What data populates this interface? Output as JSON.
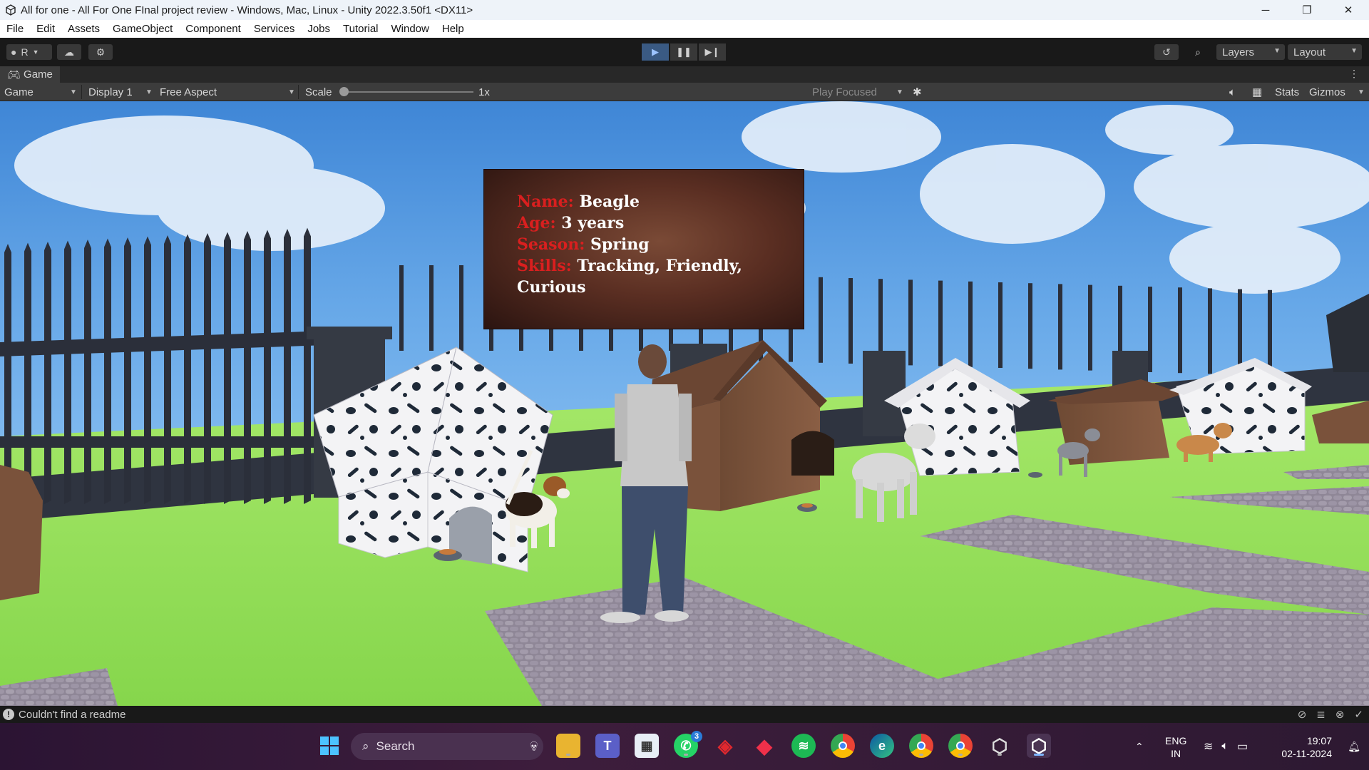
{
  "window": {
    "title": "All for one - All For One FInal project review - Windows, Mac, Linux - Unity 2022.3.50f1 <DX11>",
    "minimize": "─",
    "maximize": "❐",
    "close": "✕"
  },
  "menu": [
    "File",
    "Edit",
    "Assets",
    "GameObject",
    "Component",
    "Services",
    "Jobs",
    "Tutorial",
    "Window",
    "Help"
  ],
  "toolbar": {
    "account_label": "R",
    "layers_label": "Layers",
    "layout_label": "Layout"
  },
  "tab": {
    "label": "Game",
    "menu": "⋮"
  },
  "gamebar": {
    "view_mode": "Game",
    "display": "Display 1",
    "aspect": "Free Aspect",
    "scale_label": "Scale",
    "scale_value": "1x",
    "play_mode": "Play Focused",
    "stats_label": "Stats",
    "gizmos_label": "Gizmos"
  },
  "info_panel": {
    "name_label": "Name:",
    "name_value": "Beagle",
    "age_label": "Age:",
    "age_value": "3 years",
    "season_label": "Season:",
    "season_value": "Spring",
    "skills_label": "Skills:",
    "skills_value": "Tracking, Friendly,",
    "skills_value_cont": "Curious"
  },
  "status": {
    "message": "Couldn't find a readme",
    "icon": "!"
  },
  "taskbar": {
    "search_placeholder": "Search",
    "whatsapp_badge": "3",
    "lang_top": "ENG",
    "lang_bottom": "IN",
    "time": "19:07",
    "date": "02-11-2024"
  },
  "colors": {
    "label_red": "#d91f1f",
    "unity_dark": "#191919",
    "play_active": "#3a5a83"
  }
}
